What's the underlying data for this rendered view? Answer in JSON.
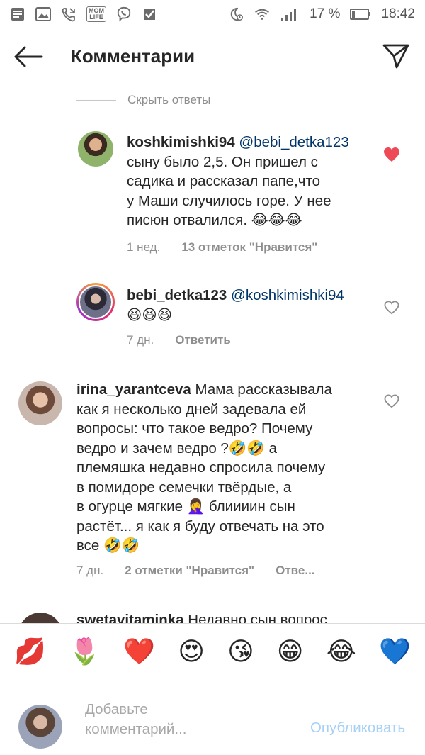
{
  "status_bar": {
    "mom_life_line1": "MOM",
    "mom_life_line2": "LIFE",
    "battery_percent": "17 %",
    "time": "18:42"
  },
  "header": {
    "title": "Комментарии"
  },
  "hide_replies_label": "Скрыть ответы",
  "comments": [
    {
      "username": "koshkimishki94",
      "mention": "@bebi_detka123",
      "text_line1": " сыну было 2,5. Он пришел с",
      "text_line2": "садика и рассказал папе,что",
      "text_line3": "у Маши случилось горе. У нее",
      "text_line4": "писюн отвалился. 😂😂😂",
      "time": "1 нед.",
      "likes": "13 отметок \"Нравится\"",
      "liked": true
    },
    {
      "username": "bebi_detka123",
      "mention": "@koshkimishki94",
      "text_line2": "😆😆😆",
      "time": "7 дн.",
      "reply": "Ответить",
      "liked": false
    },
    {
      "username": "irina_yarantceva",
      "text_line1": " Мама рассказывала",
      "text_line2": "как я несколько дней задевала ей",
      "text_line3": "вопросы: что такое ведро? Почему",
      "text_line4": "ведро и зачем ведро ?🤣🤣 а",
      "text_line5": "племяшка недавно спросила почему",
      "text_line6": "в помидоре семечки твёрдые, а",
      "text_line7": "в огурце мягкие 🤦‍♀️ блиииин сын",
      "text_line8": "растёт... я как я буду отвечать на это",
      "text_line9": "все 🤣🤣",
      "time": "7 дн.",
      "likes": "2 отметки \"Нравится\"",
      "reply": "Отве...",
      "liked": false
    },
    {
      "username": "swetavitaminka",
      "text_line1": " Недавно сын вопрос"
    }
  ],
  "emoji_bar": [
    "💋",
    "🌷",
    "❤️",
    "😍",
    "😘",
    "😁",
    "😂",
    "💙"
  ],
  "composer": {
    "placeholder_line1": "Добавьте",
    "placeholder_line2": "комментарий...",
    "publish": "Опубликовать"
  },
  "colors": {
    "like_red": "#ed4956",
    "link_blue": "#003569",
    "publish_disabled": "#a6d0f5"
  }
}
